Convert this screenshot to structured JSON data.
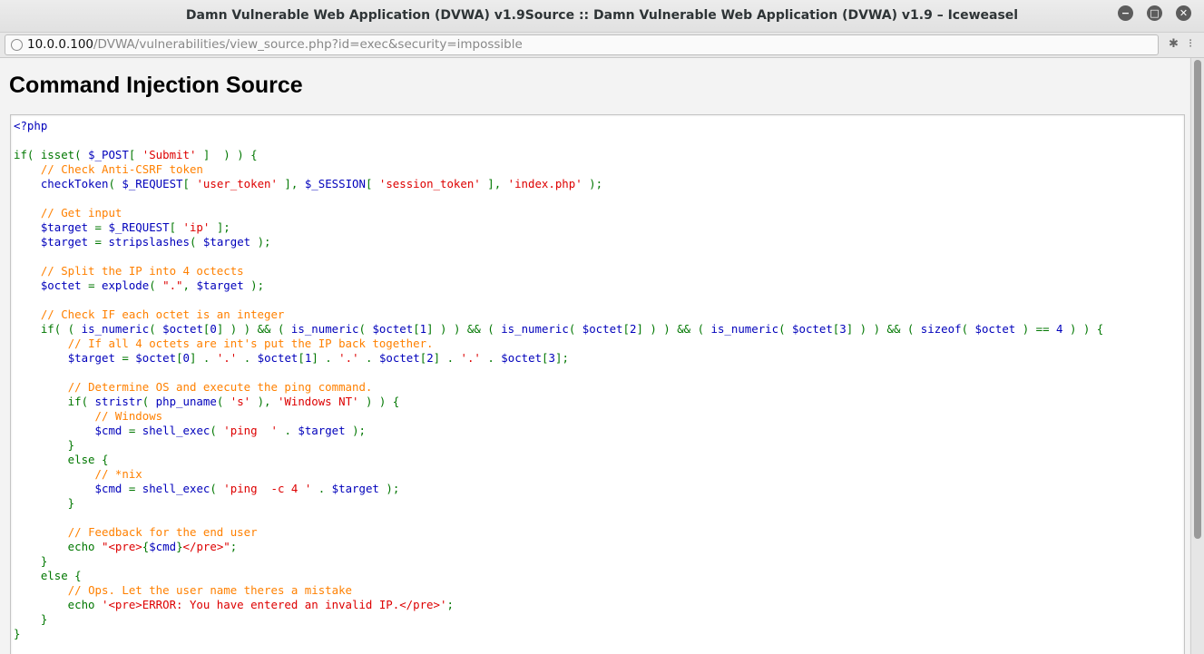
{
  "window": {
    "title": "Damn Vulnerable Web Application (DVWA) v1.9Source :: Damn Vulnerable Web Application (DVWA) v1.9 – Iceweasel",
    "minimize": "−",
    "maximize": "□",
    "close": "✕"
  },
  "urlbar": {
    "host": "10.0.0.100",
    "path": "/DVWA/vulnerabilities/view_source.php?id=exec&security=impossible"
  },
  "page": {
    "heading": "Command Injection Source"
  },
  "colors": {
    "keyword": "#007700",
    "variable": "#0000bb",
    "string": "#dd0000",
    "comment": "#ff8000"
  },
  "code_lines": [
    [
      [
        "v",
        "<?php"
      ]
    ],
    [],
    [
      [
        "k",
        "if( isset( "
      ],
      [
        "v",
        "$_POST"
      ],
      [
        "k",
        "[ "
      ],
      [
        "s",
        "'Submit'"
      ],
      [
        "k",
        " ]  ) ) {"
      ]
    ],
    [
      [
        "k",
        "    "
      ],
      [
        "c",
        "// Check Anti-CSRF token"
      ]
    ],
    [
      [
        "k",
        "    "
      ],
      [
        "v",
        "checkToken"
      ],
      [
        "k",
        "( "
      ],
      [
        "v",
        "$_REQUEST"
      ],
      [
        "k",
        "[ "
      ],
      [
        "s",
        "'user_token'"
      ],
      [
        "k",
        " ], "
      ],
      [
        "v",
        "$_SESSION"
      ],
      [
        "k",
        "[ "
      ],
      [
        "s",
        "'session_token'"
      ],
      [
        "k",
        " ], "
      ],
      [
        "s",
        "'index.php'"
      ],
      [
        "k",
        " );"
      ]
    ],
    [],
    [
      [
        "k",
        "    "
      ],
      [
        "c",
        "// Get input"
      ]
    ],
    [
      [
        "k",
        "    "
      ],
      [
        "v",
        "$target "
      ],
      [
        "k",
        "= "
      ],
      [
        "v",
        "$_REQUEST"
      ],
      [
        "k",
        "[ "
      ],
      [
        "s",
        "'ip'"
      ],
      [
        "k",
        " ];"
      ]
    ],
    [
      [
        "k",
        "    "
      ],
      [
        "v",
        "$target "
      ],
      [
        "k",
        "= "
      ],
      [
        "v",
        "stripslashes"
      ],
      [
        "k",
        "( "
      ],
      [
        "v",
        "$target "
      ],
      [
        "k",
        ");"
      ]
    ],
    [],
    [
      [
        "k",
        "    "
      ],
      [
        "c",
        "// Split the IP into 4 octects"
      ]
    ],
    [
      [
        "k",
        "    "
      ],
      [
        "v",
        "$octet "
      ],
      [
        "k",
        "= "
      ],
      [
        "v",
        "explode"
      ],
      [
        "k",
        "( "
      ],
      [
        "s",
        "\".\""
      ],
      [
        "k",
        ", "
      ],
      [
        "v",
        "$target "
      ],
      [
        "k",
        ");"
      ]
    ],
    [],
    [
      [
        "k",
        "    "
      ],
      [
        "c",
        "// Check IF each octet is an integer"
      ]
    ],
    [
      [
        "k",
        "    if( ( "
      ],
      [
        "v",
        "is_numeric"
      ],
      [
        "k",
        "( "
      ],
      [
        "v",
        "$octet"
      ],
      [
        "k",
        "["
      ],
      [
        "v",
        "0"
      ],
      [
        "k",
        "] ) ) && ( "
      ],
      [
        "v",
        "is_numeric"
      ],
      [
        "k",
        "( "
      ],
      [
        "v",
        "$octet"
      ],
      [
        "k",
        "["
      ],
      [
        "v",
        "1"
      ],
      [
        "k",
        "] ) ) && ( "
      ],
      [
        "v",
        "is_numeric"
      ],
      [
        "k",
        "( "
      ],
      [
        "v",
        "$octet"
      ],
      [
        "k",
        "["
      ],
      [
        "v",
        "2"
      ],
      [
        "k",
        "] ) ) && ( "
      ],
      [
        "v",
        "is_numeric"
      ],
      [
        "k",
        "( "
      ],
      [
        "v",
        "$octet"
      ],
      [
        "k",
        "["
      ],
      [
        "v",
        "3"
      ],
      [
        "k",
        "] ) ) && ( "
      ],
      [
        "v",
        "sizeof"
      ],
      [
        "k",
        "( "
      ],
      [
        "v",
        "$octet "
      ],
      [
        "k",
        ") == "
      ],
      [
        "v",
        "4 "
      ],
      [
        "k",
        ") ) {"
      ]
    ],
    [
      [
        "k",
        "        "
      ],
      [
        "c",
        "// If all 4 octets are int's put the IP back together."
      ]
    ],
    [
      [
        "k",
        "        "
      ],
      [
        "v",
        "$target "
      ],
      [
        "k",
        "= "
      ],
      [
        "v",
        "$octet"
      ],
      [
        "k",
        "["
      ],
      [
        "v",
        "0"
      ],
      [
        "k",
        "] . "
      ],
      [
        "s",
        "'.'"
      ],
      [
        "k",
        " . "
      ],
      [
        "v",
        "$octet"
      ],
      [
        "k",
        "["
      ],
      [
        "v",
        "1"
      ],
      [
        "k",
        "] . "
      ],
      [
        "s",
        "'.'"
      ],
      [
        "k",
        " . "
      ],
      [
        "v",
        "$octet"
      ],
      [
        "k",
        "["
      ],
      [
        "v",
        "2"
      ],
      [
        "k",
        "] . "
      ],
      [
        "s",
        "'.'"
      ],
      [
        "k",
        " . "
      ],
      [
        "v",
        "$octet"
      ],
      [
        "k",
        "["
      ],
      [
        "v",
        "3"
      ],
      [
        "k",
        "];"
      ]
    ],
    [],
    [
      [
        "k",
        "        "
      ],
      [
        "c",
        "// Determine OS and execute the ping command."
      ]
    ],
    [
      [
        "k",
        "        if( "
      ],
      [
        "v",
        "stristr"
      ],
      [
        "k",
        "( "
      ],
      [
        "v",
        "php_uname"
      ],
      [
        "k",
        "( "
      ],
      [
        "s",
        "'s'"
      ],
      [
        "k",
        " ), "
      ],
      [
        "s",
        "'Windows NT'"
      ],
      [
        "k",
        " ) ) {"
      ]
    ],
    [
      [
        "k",
        "            "
      ],
      [
        "c",
        "// Windows"
      ]
    ],
    [
      [
        "k",
        "            "
      ],
      [
        "v",
        "$cmd "
      ],
      [
        "k",
        "= "
      ],
      [
        "v",
        "shell_exec"
      ],
      [
        "k",
        "( "
      ],
      [
        "s",
        "'ping  '"
      ],
      [
        "k",
        " . "
      ],
      [
        "v",
        "$target "
      ],
      [
        "k",
        ");"
      ]
    ],
    [
      [
        "k",
        "        }"
      ]
    ],
    [
      [
        "k",
        "        else {"
      ]
    ],
    [
      [
        "k",
        "            "
      ],
      [
        "c",
        "// *nix"
      ]
    ],
    [
      [
        "k",
        "            "
      ],
      [
        "v",
        "$cmd "
      ],
      [
        "k",
        "= "
      ],
      [
        "v",
        "shell_exec"
      ],
      [
        "k",
        "( "
      ],
      [
        "s",
        "'ping  -c 4 '"
      ],
      [
        "k",
        " . "
      ],
      [
        "v",
        "$target "
      ],
      [
        "k",
        ");"
      ]
    ],
    [
      [
        "k",
        "        }"
      ]
    ],
    [],
    [
      [
        "k",
        "        "
      ],
      [
        "c",
        "// Feedback for the end user"
      ]
    ],
    [
      [
        "k",
        "        echo "
      ],
      [
        "s",
        "\"<pre>"
      ],
      [
        "k",
        "{"
      ],
      [
        "v",
        "$cmd"
      ],
      [
        "k",
        "}"
      ],
      [
        "s",
        "</pre>\""
      ],
      [
        "k",
        ";"
      ]
    ],
    [
      [
        "k",
        "    }"
      ]
    ],
    [
      [
        "k",
        "    else {"
      ]
    ],
    [
      [
        "k",
        "        "
      ],
      [
        "c",
        "// Ops. Let the user name theres a mistake"
      ]
    ],
    [
      [
        "k",
        "        echo "
      ],
      [
        "s",
        "'<pre>ERROR: You have entered an invalid IP.</pre>'"
      ],
      [
        "k",
        ";"
      ]
    ],
    [
      [
        "k",
        "    }"
      ]
    ],
    [
      [
        "k",
        "}"
      ]
    ]
  ]
}
